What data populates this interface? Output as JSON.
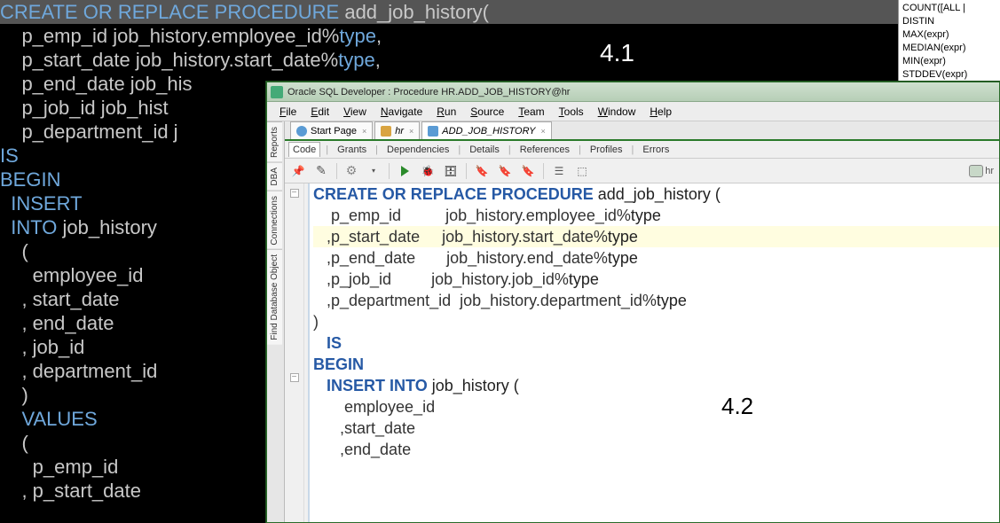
{
  "bg": {
    "label": "4.1",
    "code_lines": [
      {
        "cls": "sel",
        "l": 0,
        "pre": "",
        "kw": "CREATE OR REPLACE PROCEDURE",
        "post": " add_job_history("
      },
      {
        "l": 1,
        "t": "  p_emp_id job_history.employee_id%",
        "kwp": "type",
        "post": ","
      },
      {
        "l": 1,
        "t": "  p_start_date job_history.start_date%",
        "kwp": "type",
        "post": ","
      },
      {
        "l": 1,
        "t": "  p_end_date job_his"
      },
      {
        "l": 1,
        "t": "  p_job_id job_hist"
      },
      {
        "l": 1,
        "t": "  p_department_id j"
      },
      {
        "l": 0,
        "kw": "IS"
      },
      {
        "l": 0,
        "kw": "BEGIN"
      },
      {
        "l": 1,
        "kw": "INSERT"
      },
      {
        "l": 1,
        "kw": "INTO",
        "post": " job_history"
      },
      {
        "l": 2,
        "t": "("
      },
      {
        "l": 3,
        "t": "employee_id"
      },
      {
        "l": 2,
        "t": ", start_date"
      },
      {
        "l": 2,
        "t": ", end_date"
      },
      {
        "l": 2,
        "t": ", job_id"
      },
      {
        "l": 2,
        "t": ", department_id"
      },
      {
        "l": 2,
        "t": ")"
      },
      {
        "l": 2,
        "kw": "VALUES"
      },
      {
        "l": 2,
        "t": "("
      },
      {
        "l": 3,
        "t": "p_emp_id"
      },
      {
        "l": 2,
        "t": ", p_start_date"
      }
    ]
  },
  "snippets": [
    "COUNT([ALL | DISTIN",
    "MAX(expr)",
    "MEDIAN(expr)",
    "MIN(expr)",
    "STDDEV(expr)"
  ],
  "ide": {
    "title": "Oracle SQL Developer : Procedure HR.ADD_JOB_HISTORY@hr",
    "menu": [
      "File",
      "Edit",
      "View",
      "Navigate",
      "Run",
      "Source",
      "Team",
      "Tools",
      "Window",
      "Help"
    ],
    "side_tabs": [
      "Reports",
      "DBA",
      "Connections",
      "Find Database Object"
    ],
    "doc_tabs": [
      {
        "icon": "q",
        "label": "Start Page"
      },
      {
        "icon": "sql",
        "label": "hr",
        "italic": true
      },
      {
        "icon": "proc",
        "label": "ADD_JOB_HISTORY",
        "italic": true,
        "active": true
      }
    ],
    "sub_tabs": [
      "Code",
      "Grants",
      "Dependencies",
      "Details",
      "References",
      "Profiles",
      "Errors"
    ],
    "toolbar_right": "hr",
    "label": "4.2",
    "code_lines": [
      {
        "fold": "-",
        "t": "CREATE OR REPLACE PROCEDURE |add_job_history ("
      },
      {
        "indent": "    ",
        "t": "p_emp_id          job_history.employee_id%|type"
      },
      {
        "hl": true,
        "indent": "   ",
        "t": ",p_start_date     job_history.start_date%|type"
      },
      {
        "indent": "   ",
        "t": ",p_end_date       job_history.end_date%|type"
      },
      {
        "indent": "   ",
        "t": ",p_job_id         job_history.job_id%|type"
      },
      {
        "indent": "   ",
        "t": ",p_department_id  job_history.department_id%|type"
      },
      {
        "t": ")"
      },
      {
        "indent": "   ",
        "t": "IS|"
      },
      {
        "t": "BEGIN|"
      },
      {
        "fold": "-",
        "indent": "   ",
        "t": "INSERT INTO |job_history ("
      },
      {
        "indent": "       ",
        "t": "employee_id"
      },
      {
        "indent": "      ",
        "t": ",start_date"
      },
      {
        "indent": "      ",
        "t": ",end_date"
      }
    ]
  }
}
